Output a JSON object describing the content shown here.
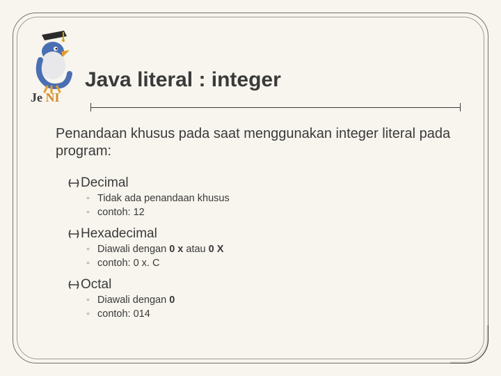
{
  "title": "Java literal : integer",
  "intro": "Penandaan khusus pada saat menggunakan integer literal pada program:",
  "sections": [
    {
      "heading": "Decimal",
      "items": [
        {
          "text": "Tidak ada penandaan khusus"
        },
        {
          "text": "contoh: 12"
        }
      ]
    },
    {
      "heading": "Hexadecimal",
      "items": [
        {
          "prefix": "Diawali dengan ",
          "bold": "0 x",
          "mid": " atau ",
          "bold2": "0 X"
        },
        {
          "text": "contoh: 0 x. C"
        }
      ]
    },
    {
      "heading": "Octal",
      "items": [
        {
          "prefix": "Diawali dengan ",
          "bold": "0"
        },
        {
          "text": "contoh: 014"
        }
      ]
    }
  ],
  "brand": "Je NI"
}
